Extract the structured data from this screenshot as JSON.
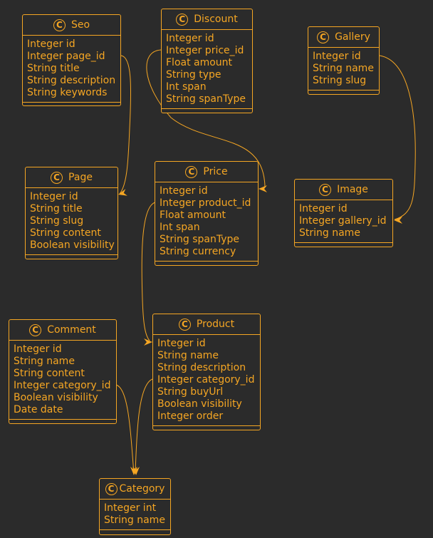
{
  "colors": {
    "background": "#2b2b2b",
    "accent": "#f5a623"
  },
  "classes": {
    "seo": {
      "name": "Seo",
      "icon": "C",
      "attrs": [
        "Integer id",
        "Integer page_id",
        "String title",
        "String description",
        "String keywords"
      ]
    },
    "discount": {
      "name": "Discount",
      "icon": "C",
      "attrs": [
        "Integer id",
        "Integer price_id",
        "Float amount",
        "String type",
        "Int span",
        "String spanType"
      ]
    },
    "gallery": {
      "name": "Gallery",
      "icon": "C",
      "attrs": [
        "Integer id",
        "String name",
        "String slug"
      ]
    },
    "page": {
      "name": "Page",
      "icon": "C",
      "attrs": [
        "Integer id",
        "String title",
        "String slug",
        "String content",
        "Boolean visibility"
      ]
    },
    "price": {
      "name": "Price",
      "icon": "C",
      "attrs": [
        "Integer id",
        "Integer product_id",
        "Float amount",
        "Int span",
        "String spanType",
        "String currency"
      ]
    },
    "image": {
      "name": "Image",
      "icon": "C",
      "attrs": [
        "Integer id",
        "Integer gallery_id",
        "String name"
      ]
    },
    "comment": {
      "name": "Comment",
      "icon": "C",
      "attrs": [
        "Integer id",
        "String name",
        "String content",
        "Integer category_id",
        "Boolean visibility",
        "Date date"
      ]
    },
    "product": {
      "name": "Product",
      "icon": "C",
      "attrs": [
        "Integer id",
        "String name",
        "String description",
        "Integer category_id",
        "String buyUrl",
        "Boolean visibility",
        "Integer order"
      ]
    },
    "category": {
      "name": "Category",
      "icon": "C",
      "attrs": [
        "Integer int",
        "String name"
      ]
    }
  },
  "relations": [
    {
      "from": "Seo.page_id",
      "to": "Page"
    },
    {
      "from": "Discount.price_id",
      "to": "Price"
    },
    {
      "from": "Gallery.id",
      "to": "Image.gallery_id"
    },
    {
      "from": "Price.product_id",
      "to": "Product"
    },
    {
      "from": "Comment.category_id",
      "to": "Category"
    },
    {
      "from": "Product.category_id",
      "to": "Category"
    }
  ]
}
